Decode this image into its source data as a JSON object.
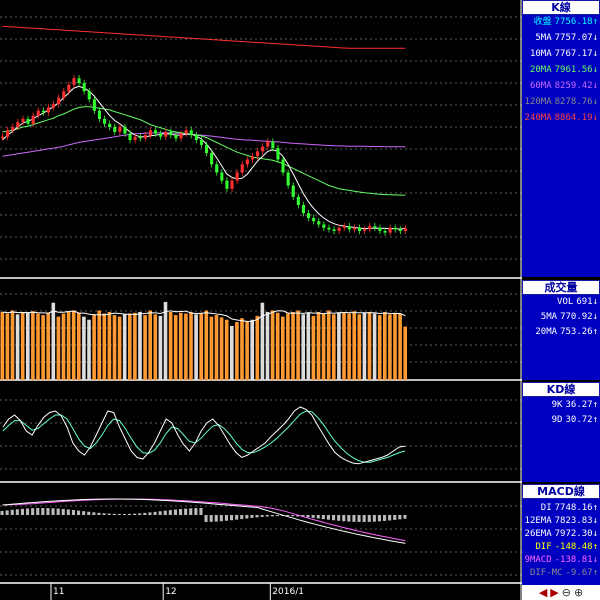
{
  "panels": {
    "k": {
      "title": "K線",
      "items": [
        {
          "label": "收盤",
          "value": "7756.18",
          "arrow": "↑",
          "color": "#00ffff"
        },
        {
          "label": "5MA",
          "value": "7757.07",
          "arrow": "↓",
          "color": "#ffffff"
        },
        {
          "label": "10MA",
          "value": "7767.17",
          "arrow": "↓",
          "color": "#ffffff"
        },
        {
          "label": "20MA",
          "value": "7961.56",
          "arrow": "↓",
          "color": "#66ff66"
        },
        {
          "label": "60MA",
          "value": "8259.42",
          "arrow": "↓",
          "color": "#cc66ff"
        },
        {
          "label": "120MA",
          "value": "8278.76",
          "arrow": "↓",
          "color": "#888888"
        },
        {
          "label": "240MA",
          "value": "8864.19",
          "arrow": "↓",
          "color": "#ff4040"
        }
      ]
    },
    "volume": {
      "title": "成交量",
      "items": [
        {
          "label": "VOL",
          "value": "691",
          "arrow": "↓",
          "color": "#ffffff"
        },
        {
          "label": "5MA",
          "value": "770.92",
          "arrow": "↓",
          "color": "#ffffff"
        },
        {
          "label": "20MA",
          "value": "753.26",
          "arrow": "↑",
          "color": "#ffffff"
        }
      ]
    },
    "kd": {
      "title": "KD線",
      "items": [
        {
          "label": "9K",
          "value": "36.27",
          "arrow": "↑",
          "color": "#ffffff"
        },
        {
          "label": "9D",
          "value": "30.72",
          "arrow": "↑",
          "color": "#ffffff"
        }
      ]
    },
    "macd": {
      "title": "MACD線",
      "items": [
        {
          "label": "DI",
          "value": "7748.16",
          "arrow": "↑",
          "color": "#ffffff"
        },
        {
          "label": "12EMA",
          "value": "7823.83",
          "arrow": "↓",
          "color": "#ffffff"
        },
        {
          "label": "26EMA",
          "value": "7972.30",
          "arrow": "↓",
          "color": "#ffffff"
        },
        {
          "label": "DIF",
          "value": "-148.48",
          "arrow": "↑",
          "color": "#ffff00"
        },
        {
          "label": "9MACD",
          "value": "-138.81",
          "arrow": "↓",
          "color": "#ff66ff"
        },
        {
          "label": "DIF-MC",
          "value": "-9.67",
          "arrow": "↑",
          "color": "#888888"
        }
      ]
    }
  },
  "x_axis_labels": [
    {
      "text": "11",
      "index": 10
    },
    {
      "text": "12",
      "index": 32
    },
    {
      "text": "2016/1",
      "index": 53
    }
  ],
  "toolbar": {
    "prev_icon": "arrow-left-icon",
    "next_icon": "arrow-right-icon",
    "zoom_out_icon": "zoom-out-icon",
    "zoom_in_icon": "zoom-in-icon"
  },
  "chart_data": {
    "type": "candlestick",
    "bars": 80,
    "price_ylim": [
      7500,
      9100
    ],
    "close": [
      8320,
      8360,
      8380,
      8410,
      8430,
      8400,
      8450,
      8480,
      8470,
      8500,
      8520,
      8560,
      8600,
      8640,
      8680,
      8650,
      8600,
      8550,
      8480,
      8430,
      8400,
      8380,
      8350,
      8380,
      8340,
      8300,
      8320,
      8310,
      8330,
      8360,
      8340,
      8320,
      8350,
      8330,
      8310,
      8340,
      8360,
      8330,
      8300,
      8270,
      8220,
      8150,
      8100,
      8050,
      8000,
      8050,
      8100,
      8150,
      8180,
      8200,
      8230,
      8260,
      8290,
      8250,
      8180,
      8100,
      8020,
      7950,
      7900,
      7850,
      7820,
      7800,
      7780,
      7760,
      7750,
      7740,
      7760,
      7770,
      7750,
      7760,
      7740,
      7750,
      7770,
      7760,
      7740,
      7730,
      7760,
      7750,
      7740,
      7756
    ],
    "ma5": [
      8300,
      8330,
      8355,
      8380,
      8405,
      8415,
      8430,
      8450,
      8465,
      8485,
      8505,
      8530,
      8560,
      8590,
      8620,
      8630,
      8620,
      8600,
      8570,
      8530,
      8490,
      8450,
      8420,
      8400,
      8375,
      8350,
      8330,
      8320,
      8320,
      8325,
      8330,
      8335,
      8340,
      8335,
      8330,
      8330,
      8335,
      8335,
      8325,
      8305,
      8275,
      8235,
      8190,
      8140,
      8090,
      8070,
      8060,
      8065,
      8090,
      8130,
      8170,
      8200,
      8230,
      8240,
      8230,
      8200,
      8150,
      8090,
      8030,
      7970,
      7920,
      7880,
      7845,
      7820,
      7800,
      7785,
      7775,
      7770,
      7765,
      7762,
      7758,
      7755,
      7756,
      7758,
      7757,
      7756,
      7755,
      7755,
      7752,
      7757
    ],
    "ma20": [
      8350,
      8355,
      8360,
      8370,
      8380,
      8385,
      8395,
      8405,
      8415,
      8425,
      8435,
      8450,
      8460,
      8475,
      8490,
      8500,
      8505,
      8505,
      8500,
      8495,
      8490,
      8485,
      8475,
      8465,
      8455,
      8445,
      8435,
      8425,
      8410,
      8395,
      8385,
      8375,
      8365,
      8355,
      8350,
      8345,
      8340,
      8335,
      8330,
      8325,
      8315,
      8300,
      8285,
      8270,
      8255,
      8240,
      8225,
      8215,
      8205,
      8195,
      8190,
      8185,
      8180,
      8175,
      8165,
      8155,
      8140,
      8125,
      8110,
      8095,
      8080,
      8065,
      8050,
      8035,
      8020,
      8010,
      8000,
      7995,
      7990,
      7985,
      7980,
      7975,
      7972,
      7968,
      7966,
      7964,
      7963,
      7962,
      7961,
      7961
    ],
    "ma60": [
      8200,
      8205,
      8210,
      8215,
      8220,
      8225,
      8230,
      8235,
      8240,
      8245,
      8250,
      8255,
      8262,
      8270,
      8278,
      8285,
      8290,
      8295,
      8300,
      8305,
      8310,
      8315,
      8320,
      8325,
      8330,
      8335,
      8338,
      8340,
      8342,
      8343,
      8344,
      8345,
      8345,
      8344,
      8342,
      8340,
      8338,
      8335,
      8332,
      8330,
      8327,
      8324,
      8320,
      8316,
      8312,
      8308,
      8305,
      8302,
      8300,
      8298,
      8296,
      8294,
      8292,
      8290,
      8288,
      8285,
      8282,
      8280,
      8278,
      8276,
      8274,
      8272,
      8270,
      8268,
      8266,
      8265,
      8264,
      8263,
      8262,
      8262,
      8261,
      8261,
      8260,
      8260,
      8260,
      8259,
      8259,
      8259,
      8259,
      8259
    ],
    "ma240": [
      9000,
      8998,
      8996,
      8994,
      8992,
      8990,
      8988,
      8986,
      8984,
      8982,
      8980,
      8978,
      8976,
      8974,
      8972,
      8970,
      8968,
      8966,
      8964,
      8962,
      8960,
      8958,
      8956,
      8954,
      8952,
      8950,
      8948,
      8946,
      8944,
      8942,
      8940,
      8938,
      8936,
      8934,
      8932,
      8930,
      8928,
      8926,
      8924,
      8922,
      8920,
      8918,
      8916,
      8914,
      8912,
      8910,
      8908,
      8906,
      8904,
      8902,
      8900,
      8898,
      8896,
      8894,
      8892,
      8890,
      8888,
      8886,
      8884,
      8882,
      8880,
      8878,
      8876,
      8874,
      8872,
      8870,
      8868,
      8866,
      8865,
      8864,
      8864,
      8864,
      8864,
      8864,
      8864,
      8864,
      8864,
      8864,
      8864,
      8864
    ],
    "volume": [
      880,
      860,
      900,
      850,
      880,
      870,
      890,
      860,
      840,
      870,
      1000,
      820,
      860,
      880,
      900,
      870,
      820,
      780,
      850,
      900,
      860,
      880,
      840,
      820,
      850,
      860,
      870,
      880,
      840,
      900,
      850,
      830,
      1010,
      880,
      840,
      870,
      860,
      880,
      850,
      860,
      900,
      820,
      840,
      810,
      780,
      700,
      750,
      800,
      760,
      780,
      830,
      1000,
      880,
      900,
      870,
      820,
      860,
      880,
      900,
      850,
      870,
      830,
      880,
      860,
      900,
      850,
      870,
      880,
      860,
      890,
      850,
      870,
      880,
      860,
      840,
      880,
      850,
      870,
      860,
      691
    ],
    "volume_ylim": [
      0,
      1100
    ],
    "kd_k": [
      60,
      70,
      75,
      68,
      55,
      50,
      62,
      72,
      78,
      80,
      74,
      60,
      40,
      30,
      25,
      35,
      50,
      65,
      80,
      78,
      60,
      45,
      30,
      22,
      20,
      28,
      40,
      55,
      70,
      65,
      50,
      38,
      30,
      40,
      55,
      65,
      70,
      62,
      50,
      38,
      28,
      22,
      25,
      30,
      35,
      40,
      48,
      55,
      62,
      70,
      80,
      85,
      82,
      75,
      62,
      50,
      38,
      28,
      22,
      18,
      15,
      14,
      16,
      18,
      20,
      22,
      25,
      30,
      35,
      36
    ],
    "kd_d": [
      55,
      62,
      68,
      68,
      62,
      56,
      58,
      64,
      70,
      75,
      75,
      70,
      58,
      45,
      36,
      33,
      40,
      50,
      62,
      70,
      68,
      58,
      46,
      35,
      28,
      27,
      31,
      40,
      52,
      60,
      58,
      50,
      42,
      40,
      46,
      54,
      61,
      63,
      58,
      50,
      40,
      32,
      28,
      28,
      31,
      35,
      40,
      46,
      53,
      60,
      68,
      76,
      80,
      79,
      72,
      63,
      52,
      42,
      34,
      27,
      22,
      18,
      16,
      16,
      18,
      20,
      22,
      25,
      28,
      30
    ]
  }
}
